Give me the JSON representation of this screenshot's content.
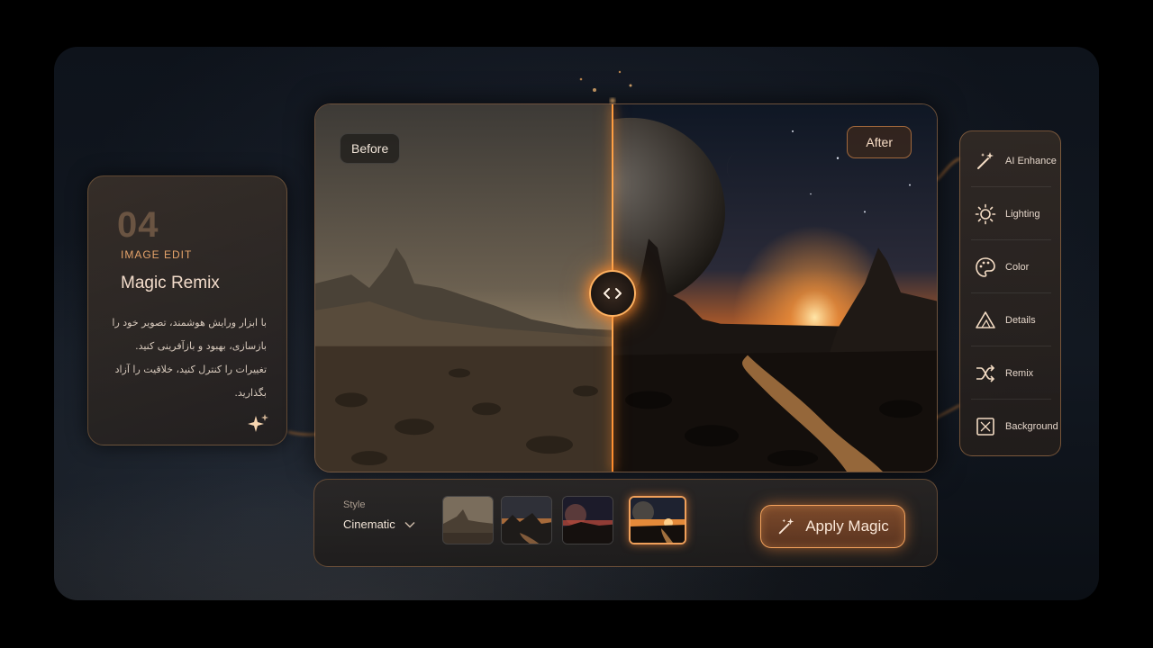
{
  "info_card": {
    "number": "04",
    "eyebrow": "IMAGE EDIT",
    "title": "Magic Remix",
    "description_lines": [
      "با ابزار ورایش هوشمند، تصویر خود را",
      "بازسازی، بهبود و بازآفرینی کنید.",
      "تغییرات را کنترل کنید، خلاقیت را آزاد",
      "بگذارید."
    ]
  },
  "compare": {
    "before_label": "Before",
    "after_label": "After"
  },
  "tools": [
    {
      "label": "AI Enhance",
      "icon": "magic-wand-icon"
    },
    {
      "label": "Lighting",
      "icon": "sun-icon"
    },
    {
      "label": "Color",
      "icon": "palette-icon"
    },
    {
      "label": "Details",
      "icon": "triangle-icon"
    },
    {
      "label": "Remix",
      "icon": "shuffle-icon"
    },
    {
      "label": "Background",
      "icon": "background-icon"
    }
  ],
  "style": {
    "label": "Style",
    "selected": "Cinematic",
    "thumbnails": [
      {
        "name": "desert-day"
      },
      {
        "name": "dusk-valley"
      },
      {
        "name": "red-planet-night"
      },
      {
        "name": "sunset-river",
        "selected": true
      }
    ]
  },
  "apply_button": {
    "label": "Apply Magic"
  },
  "colors": {
    "accent": "#f4a35d",
    "glow": "#ff8a2a",
    "background": "#0e131b"
  }
}
